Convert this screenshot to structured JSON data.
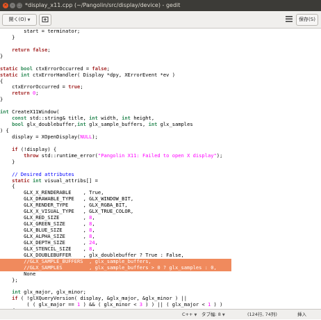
{
  "window": {
    "title": "*display_x11.cpp (~/Pangolin/src/display/device) - gedit"
  },
  "toolbar": {
    "open_label": "開く(O)",
    "save_label": "保存(S)"
  },
  "statusbar": {
    "language": "C++",
    "tab_width": "タブ幅: 8",
    "position": "(124行, 74列)",
    "insert_mode": "挿入"
  },
  "highlight_color": "#f08a5d",
  "code_lines": [
    [
      {
        "t": "        start = terminator;"
      }
    ],
    [
      {
        "t": "    }"
      }
    ],
    [
      {
        "t": ""
      }
    ],
    [
      {
        "t": "    "
      },
      {
        "t": "return",
        "c": "kw"
      },
      {
        "t": " "
      },
      {
        "t": "false",
        "c": "kw"
      },
      {
        "t": ";"
      }
    ],
    [
      {
        "t": "}"
      }
    ],
    [
      {
        "t": ""
      }
    ],
    [
      {
        "t": "static",
        "c": "kw"
      },
      {
        "t": " "
      },
      {
        "t": "bool",
        "c": "ty"
      },
      {
        "t": " ctxErrorOccurred = "
      },
      {
        "t": "false",
        "c": "kw"
      },
      {
        "t": ";"
      }
    ],
    [
      {
        "t": "static",
        "c": "kw"
      },
      {
        "t": " "
      },
      {
        "t": "int",
        "c": "ty"
      },
      {
        "t": " ctxErrorHandler( Display *dpy, XErrorEvent *ev )"
      }
    ],
    [
      {
        "t": "{"
      }
    ],
    [
      {
        "t": "    ctxErrorOccurred = "
      },
      {
        "t": "true",
        "c": "kw"
      },
      {
        "t": ";"
      }
    ],
    [
      {
        "t": "    "
      },
      {
        "t": "return",
        "c": "kw"
      },
      {
        "t": " "
      },
      {
        "t": "0",
        "c": "num"
      },
      {
        "t": ";"
      }
    ],
    [
      {
        "t": "}"
      }
    ],
    [
      {
        "t": ""
      }
    ],
    [
      {
        "t": "int",
        "c": "ty"
      },
      {
        "t": " CreateX11Window("
      }
    ],
    [
      {
        "t": "    "
      },
      {
        "t": "const",
        "c": "ty"
      },
      {
        "t": " std::string& title, "
      },
      {
        "t": "int",
        "c": "ty"
      },
      {
        "t": " width, "
      },
      {
        "t": "int",
        "c": "ty"
      },
      {
        "t": " height,"
      }
    ],
    [
      {
        "t": "    "
      },
      {
        "t": "bool",
        "c": "ty"
      },
      {
        "t": " glx_doublebuffer,"
      },
      {
        "t": "int",
        "c": "ty"
      },
      {
        "t": " glx_sample_buffers, "
      },
      {
        "t": "int",
        "c": "ty"
      },
      {
        "t": " glx_samples"
      }
    ],
    [
      {
        "t": ") {"
      }
    ],
    [
      {
        "t": "    display = XOpenDisplay("
      },
      {
        "t": "NULL",
        "c": "num"
      },
      {
        "t": ");"
      }
    ],
    [
      {
        "t": ""
      }
    ],
    [
      {
        "t": "    "
      },
      {
        "t": "if",
        "c": "kw"
      },
      {
        "t": " (!display) {"
      }
    ],
    [
      {
        "t": "        "
      },
      {
        "t": "throw",
        "c": "kw"
      },
      {
        "t": " std::runtime_error("
      },
      {
        "t": "\"Pangolin X11: Failed to open X display\"",
        "c": "str"
      },
      {
        "t": ");"
      }
    ],
    [
      {
        "t": "    }"
      }
    ],
    [
      {
        "t": ""
      }
    ],
    [
      {
        "t": "    "
      },
      {
        "t": "// Desired attributes",
        "c": "cm"
      }
    ],
    [
      {
        "t": "    "
      },
      {
        "t": "static",
        "c": "kw"
      },
      {
        "t": " "
      },
      {
        "t": "int",
        "c": "ty"
      },
      {
        "t": " visual_attribs[] ="
      }
    ],
    [
      {
        "t": "    {"
      }
    ],
    [
      {
        "t": "        GLX_X_RENDERABLE    , True,"
      }
    ],
    [
      {
        "t": "        GLX_DRAWABLE_TYPE   , GLX_WINDOW_BIT,"
      }
    ],
    [
      {
        "t": "        GLX_RENDER_TYPE     , GLX_RGBA_BIT,"
      }
    ],
    [
      {
        "t": "        GLX_X_VISUAL_TYPE   , GLX_TRUE_COLOR,"
      }
    ],
    [
      {
        "t": "        GLX_RED_SIZE        , "
      },
      {
        "t": "8",
        "c": "num"
      },
      {
        "t": ","
      }
    ],
    [
      {
        "t": "        GLX_GREEN_SIZE      , "
      },
      {
        "t": "8",
        "c": "num"
      },
      {
        "t": ","
      }
    ],
    [
      {
        "t": "        GLX_BLUE_SIZE       , "
      },
      {
        "t": "8",
        "c": "num"
      },
      {
        "t": ","
      }
    ],
    [
      {
        "t": "        GLX_ALPHA_SIZE      , "
      },
      {
        "t": "8",
        "c": "num"
      },
      {
        "t": ","
      }
    ],
    [
      {
        "t": "        GLX_DEPTH_SIZE      , "
      },
      {
        "t": "24",
        "c": "num"
      },
      {
        "t": ","
      }
    ],
    [
      {
        "t": "        GLX_STENCIL_SIZE    , "
      },
      {
        "t": "8",
        "c": "num"
      },
      {
        "t": ","
      }
    ],
    [
      {
        "t": "        GLX_DOUBLEBUFFER    , glx_doublebuffer ? True : False,"
      }
    ],
    {
      "hl": true,
      "segs": [
        {
          "t": "        //GLX_SAMPLE_BUFFERS  , glx_sample_buffers,"
        }
      ]
    },
    {
      "hl": true,
      "segs": [
        {
          "t": "        //GLX_SAMPLES         , glx_sample_buffers > 0 ? glx_samples : 0,"
        }
      ]
    },
    [
      {
        "t": "        None"
      }
    ],
    [
      {
        "t": "    };"
      }
    ],
    [
      {
        "t": ""
      }
    ],
    [
      {
        "t": "    "
      },
      {
        "t": "int",
        "c": "ty"
      },
      {
        "t": " glx_major, glx_minor;"
      }
    ],
    [
      {
        "t": "    "
      },
      {
        "t": "if",
        "c": "kw"
      },
      {
        "t": " ( !glXQueryVersion( display, &glx_major, &glx_minor ) ||"
      }
    ],
    [
      {
        "t": "         ( ( glx_major == "
      },
      {
        "t": "1",
        "c": "num"
      },
      {
        "t": " ) && ( glx_minor < "
      },
      {
        "t": "3",
        "c": "num"
      },
      {
        "t": " ) ) || ( glx_major < "
      },
      {
        "t": "1",
        "c": "num"
      },
      {
        "t": " ) )"
      }
    ],
    [
      {
        "t": "    {"
      }
    ]
  ]
}
